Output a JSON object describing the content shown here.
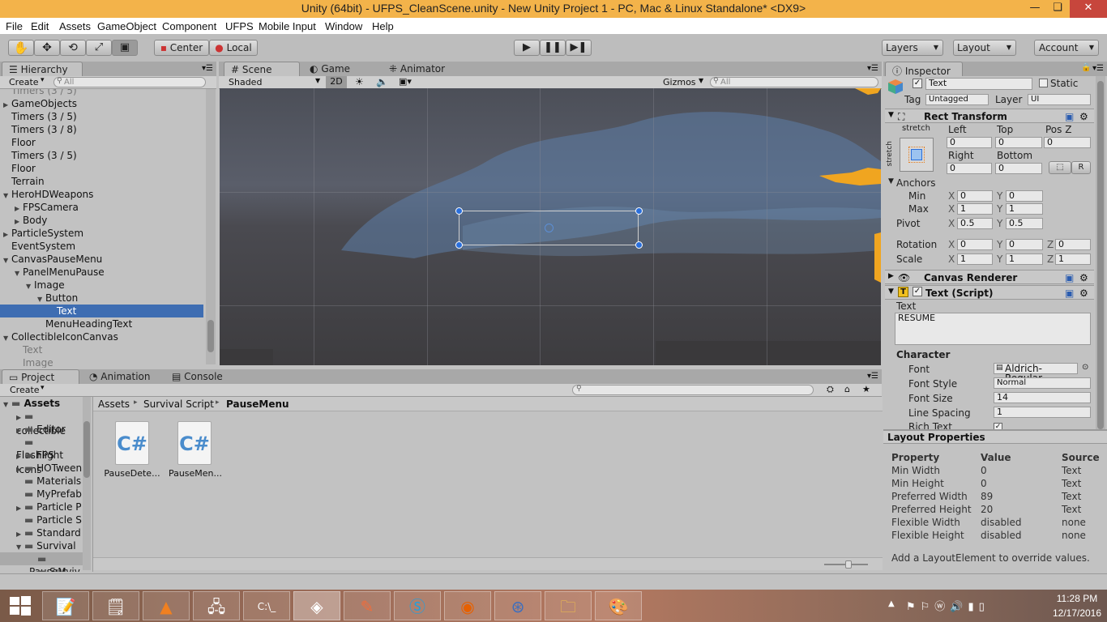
{
  "window": {
    "title": "Unity (64bit) - UFPS_CleanScene.unity - New Unity Project 1 - PC, Mac & Linux Standalone* <DX9>",
    "minimize": "—",
    "restore": "❏",
    "close": "✕"
  },
  "menu": [
    "File",
    "Edit",
    "Assets",
    "GameObject",
    "Component",
    "UFPS",
    "Mobile Input",
    "Window",
    "Help"
  ],
  "toolbar": {
    "center": "Center",
    "local": "Local",
    "layers": "Layers",
    "layout": "Layout",
    "account": "Account"
  },
  "hierarchy": {
    "tab": "Hierarchy",
    "create": "Create",
    "search_placeholder": "All",
    "items": [
      {
        "label": "Timers (3 / 5)",
        "depth": 0,
        "arrow": "",
        "state": "grey"
      },
      {
        "label": "GameObjects",
        "depth": 0,
        "arrow": "▶",
        "state": ""
      },
      {
        "label": "Timers (3 / 5)",
        "depth": 0,
        "arrow": "",
        "state": ""
      },
      {
        "label": "Timers (3 / 8)",
        "depth": 0,
        "arrow": "",
        "state": ""
      },
      {
        "label": "Floor",
        "depth": 0,
        "arrow": "",
        "state": ""
      },
      {
        "label": "Timers (3 / 5)",
        "depth": 0,
        "arrow": "",
        "state": ""
      },
      {
        "label": "Floor",
        "depth": 0,
        "arrow": "",
        "state": ""
      },
      {
        "label": "Terrain",
        "depth": 0,
        "arrow": "",
        "state": ""
      },
      {
        "label": "HeroHDWeapons",
        "depth": 0,
        "arrow": "▼",
        "state": ""
      },
      {
        "label": "FPSCamera",
        "depth": 1,
        "arrow": "▶",
        "state": ""
      },
      {
        "label": "Body",
        "depth": 1,
        "arrow": "▶",
        "state": ""
      },
      {
        "label": "ParticleSystem",
        "depth": 0,
        "arrow": "▶",
        "state": ""
      },
      {
        "label": "EventSystem",
        "depth": 0,
        "arrow": "",
        "state": ""
      },
      {
        "label": "CanvasPauseMenu",
        "depth": 0,
        "arrow": "▼",
        "state": ""
      },
      {
        "label": "PanelMenuPause",
        "depth": 1,
        "arrow": "▼",
        "state": ""
      },
      {
        "label": "Image",
        "depth": 2,
        "arrow": "▼",
        "state": ""
      },
      {
        "label": "Button",
        "depth": 3,
        "arrow": "▼",
        "state": ""
      },
      {
        "label": "Text",
        "depth": 4,
        "arrow": "",
        "state": "sel"
      },
      {
        "label": "MenuHeadingText",
        "depth": 3,
        "arrow": "",
        "state": ""
      },
      {
        "label": "CollectibleIconCanvas",
        "depth": 0,
        "arrow": "▼",
        "state": ""
      },
      {
        "label": "Text",
        "depth": 1,
        "arrow": "",
        "state": "grey"
      },
      {
        "label": "Image",
        "depth": 1,
        "arrow": "",
        "state": "grey"
      }
    ]
  },
  "scene_tabs": {
    "scene": "Scene",
    "game": "Game",
    "animator": "Animator",
    "shaded": "Shaded",
    "mode2d": "2D",
    "gizmos": "Gizmos",
    "search_placeholder": "All"
  },
  "project": {
    "tabs": [
      "Project",
      "Animation",
      "Console"
    ],
    "create": "Create",
    "breadcrumb": [
      "Assets",
      "Survival Script",
      "PauseMenu"
    ],
    "tree": [
      {
        "label": "Assets",
        "depth": 0,
        "arrow": "▼",
        "bold": true
      },
      {
        "label": "collectible",
        "depth": 1,
        "arrow": "▶"
      },
      {
        "label": "Editor",
        "depth": 1,
        "arrow": "▶"
      },
      {
        "label": "Flashlight",
        "depth": 1,
        "arrow": ""
      },
      {
        "label": "FPS Icons",
        "depth": 1,
        "arrow": "▶"
      },
      {
        "label": "HOTween",
        "depth": 1,
        "arrow": "▶"
      },
      {
        "label": "Materials",
        "depth": 1,
        "arrow": ""
      },
      {
        "label": "MyPrefab",
        "depth": 1,
        "arrow": ""
      },
      {
        "label": "Particle P",
        "depth": 1,
        "arrow": "▶"
      },
      {
        "label": "Particle S",
        "depth": 1,
        "arrow": ""
      },
      {
        "label": "Standard",
        "depth": 1,
        "arrow": "▶"
      },
      {
        "label": "Survival S",
        "depth": 1,
        "arrow": "▼"
      },
      {
        "label": "PauseM",
        "depth": 2,
        "arrow": ""
      },
      {
        "label": "Surviv",
        "depth": 2,
        "arrow": ""
      }
    ],
    "files": [
      {
        "name": "PauseDete...",
        "glyph": "C#"
      },
      {
        "name": "PauseMen...",
        "glyph": "C#"
      }
    ]
  },
  "inspector": {
    "tab": "Inspector",
    "object_name": "Text",
    "static": "Static",
    "tag_label": "Tag",
    "tag": "Untagged",
    "layer_label": "Layer",
    "layer": "UI",
    "rect_transform": "Rect Transform",
    "stretch": "stretch",
    "left_label": "Left",
    "top_label": "Top",
    "posz_label": "Pos Z",
    "left": "0",
    "top": "0",
    "posz": "0",
    "right_label": "Right",
    "bottom_label": "Bottom",
    "right": "0",
    "bottom": "0",
    "anchors": "Anchors",
    "min": "Min",
    "max": "Max",
    "min_x": "0",
    "min_y": "0",
    "max_x": "1",
    "max_y": "1",
    "pivot": "Pivot",
    "pivot_x": "0.5",
    "pivot_y": "0.5",
    "rotation": "Rotation",
    "rot_x": "0",
    "rot_y": "0",
    "rot_z": "0",
    "scale": "Scale",
    "scale_x": "1",
    "scale_y": "1",
    "scale_z": "1",
    "canvas_renderer": "Canvas Renderer",
    "text_script": "Text (Script)",
    "text_label": "Text",
    "text_value": "RESUME",
    "character": "Character",
    "font_label": "Font",
    "font": "Aldrich-Regular",
    "font_style_label": "Font Style",
    "font_style": "Normal",
    "font_size_label": "Font Size",
    "font_size": "14",
    "line_spacing_label": "Line Spacing",
    "line_spacing": "1",
    "rich_text_label": "Rich Text",
    "x": "X",
    "y": "Y",
    "z": "Z",
    "r": "R"
  },
  "layout_props": {
    "title": "Layout Properties",
    "headers": [
      "Property",
      "Value",
      "Source"
    ],
    "rows": [
      [
        "Min Width",
        "0",
        "Text"
      ],
      [
        "Min Height",
        "0",
        "Text"
      ],
      [
        "Preferred Width",
        "89",
        "Text"
      ],
      [
        "Preferred Height",
        "20",
        "Text"
      ],
      [
        "Flexible Width",
        "disabled",
        "none"
      ],
      [
        "Flexible Height",
        "disabled",
        "none"
      ]
    ],
    "footer": "Add a LayoutElement to override values."
  },
  "taskbar": {
    "time": "11:28 PM",
    "date": "12/17/2016"
  },
  "colors": {
    "title_bar": "#f3b34a",
    "selection": "#3e6db2",
    "close": "#c7463c"
  }
}
